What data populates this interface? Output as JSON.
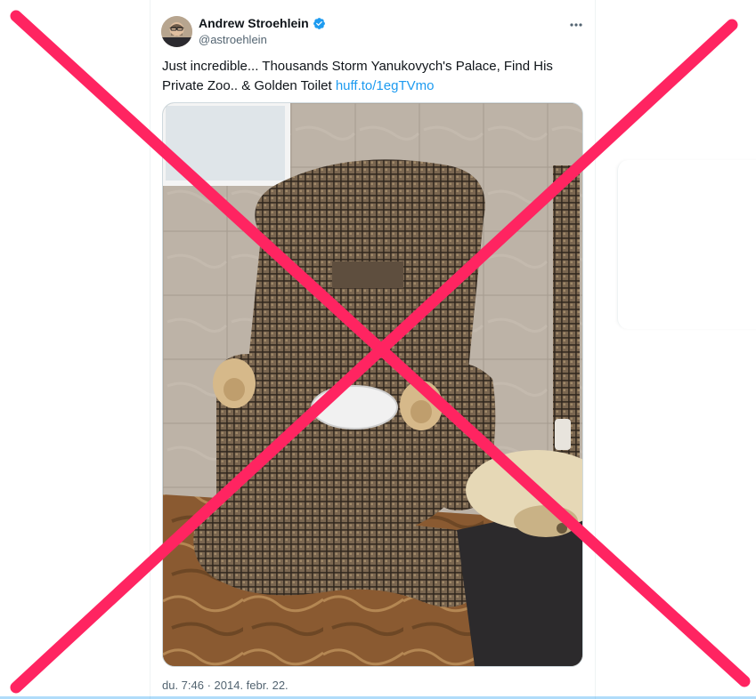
{
  "tweet": {
    "author_name": "Andrew Stroehlein",
    "handle": "@astroehlein",
    "text_before_link": "Just incredible... Thousands Storm Yanukovych's Palace, Find His Private Zoo.. & Golden Toilet ",
    "link_text": "huff.to/1egTVmo",
    "timestamp": "du. 7:46 · 2014. febr. 22."
  },
  "icons": {
    "verified": "verified-badge-icon",
    "more": "more-options-icon"
  },
  "overlay": {
    "cross_color": "#ff2461"
  },
  "colors": {
    "link": "#1d9bf0",
    "secondary_text": "#536471",
    "verified": "#1d9bf0"
  }
}
